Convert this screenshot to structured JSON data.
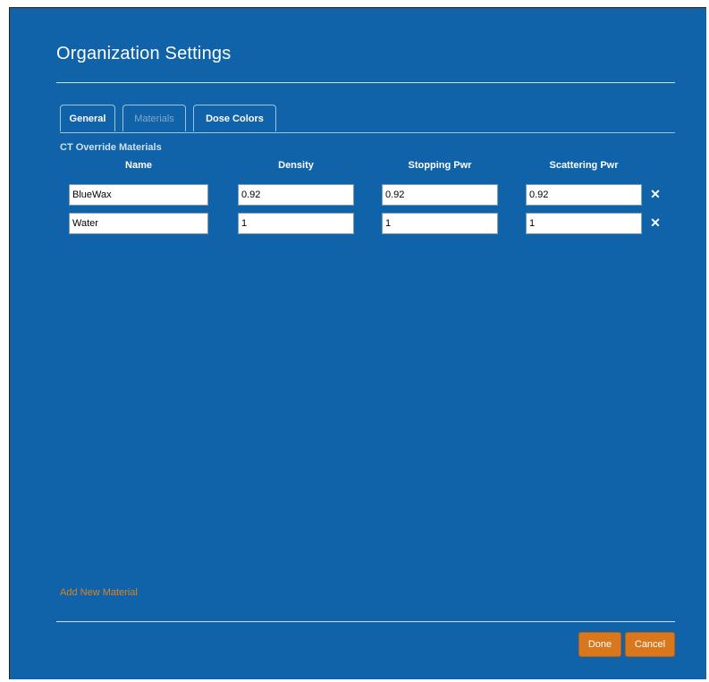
{
  "dialog": {
    "title": "Organization Settings"
  },
  "tabs": [
    {
      "label": "General",
      "active": false
    },
    {
      "label": "Materials",
      "active": true
    },
    {
      "label": "Dose Colors",
      "active": false
    }
  ],
  "materials": {
    "section_label": "CT Override Materials",
    "columns": [
      "Name",
      "Density",
      "Stopping Pwr",
      "Scattering Pwr"
    ],
    "rows": [
      {
        "name": "BlueWax",
        "density": "0.92",
        "stopping_pwr": "0.92",
        "scattering_pwr": "0.92"
      },
      {
        "name": "Water",
        "density": "1",
        "stopping_pwr": "1",
        "scattering_pwr": "1"
      }
    ],
    "remove_icon": "close-icon",
    "add_label": "Add New Material"
  },
  "footer": {
    "done_label": "Done",
    "cancel_label": "Cancel"
  },
  "colors": {
    "background": "#1063a8",
    "button": "#d9771c",
    "link": "#d98324"
  }
}
